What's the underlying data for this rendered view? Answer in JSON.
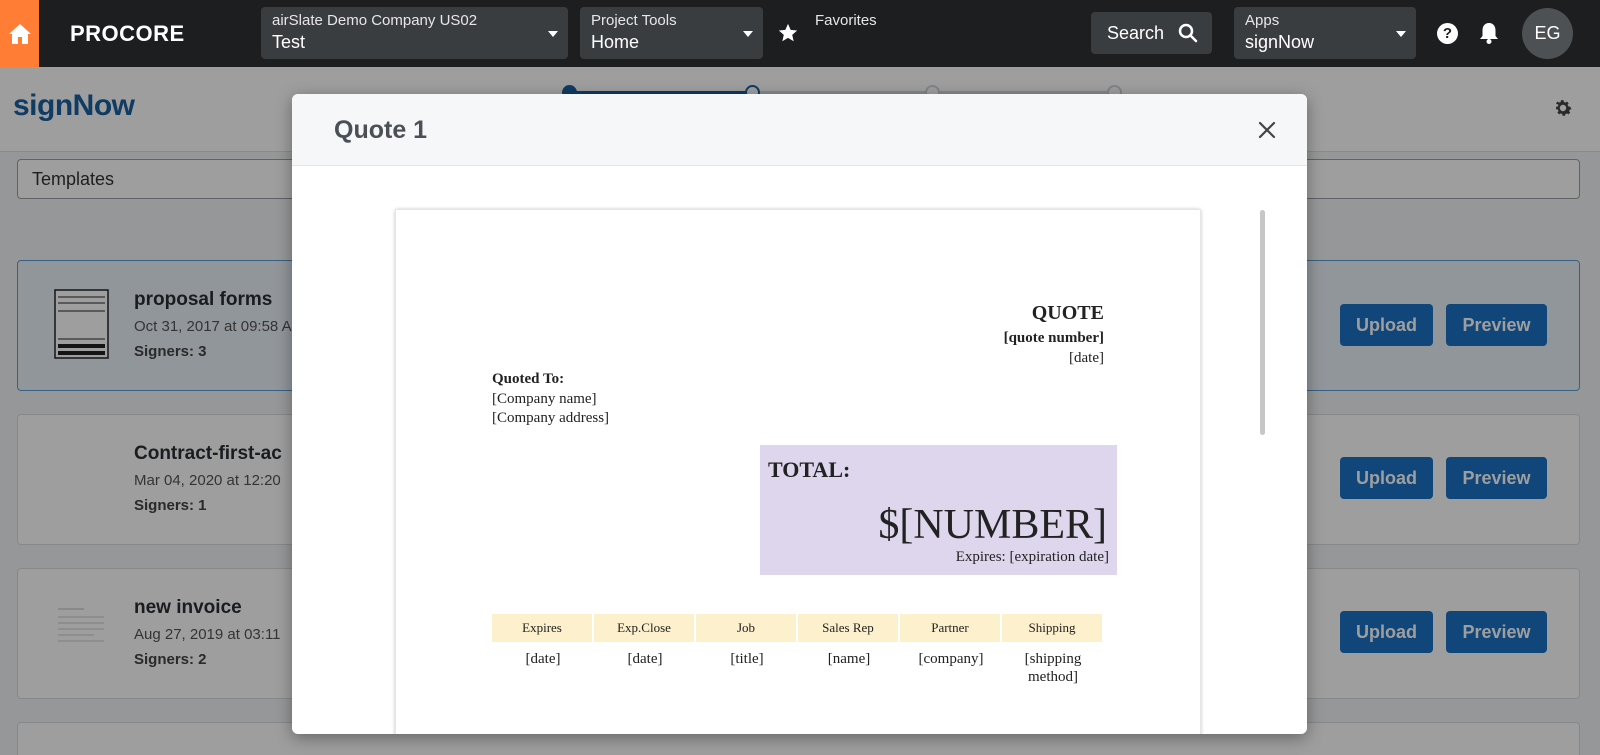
{
  "topbar": {
    "logo": "PROCORE",
    "company": {
      "small": "airSlate Demo Company US02",
      "big": "Test"
    },
    "tools": {
      "small": "Project Tools",
      "big": "Home"
    },
    "favorites": "Favorites",
    "search_label": "Search",
    "apps": {
      "small": "Apps",
      "big": "signNow"
    },
    "help": "?",
    "avatar": "EG",
    "accent": "#ff7d35"
  },
  "app": {
    "brand": "signNow",
    "templates_label": "Templates",
    "cards": [
      {
        "title": "proposal forms",
        "date": "Oct 31, 2017 at 09:58 A",
        "signers": "Signers: 3",
        "upload": "Upload",
        "preview": "Preview"
      },
      {
        "title": "Contract-first-ac",
        "date": "Mar 04, 2020 at 12:20",
        "signers": "Signers: 1",
        "upload": "Upload",
        "preview": "Preview"
      },
      {
        "title": "new invoice",
        "date": "Aug 27, 2019 at 03:11",
        "signers": "Signers: 2",
        "upload": "Upload",
        "preview": "Preview"
      }
    ],
    "button_color": "#1a71c4"
  },
  "modal": {
    "title": "Quote 1",
    "doc": {
      "heading": "QUOTE",
      "quote_number": "[quote number]",
      "date": "[date]",
      "quoted_to": "Quoted To:",
      "company_name": "[Company name]",
      "company_address": "[Company address]",
      "total_label": "TOTAL:",
      "total_value": "$[NUMBER]",
      "expires": "Expires: [expiration date]",
      "table": {
        "headers": [
          "Expires",
          "Exp.Close",
          "Job",
          "Sales Rep",
          "Partner",
          "Shipping"
        ],
        "values": [
          "[date]",
          "[date]",
          "[title]",
          "[name]",
          "[company]",
          "[shipping method]"
        ]
      }
    }
  }
}
